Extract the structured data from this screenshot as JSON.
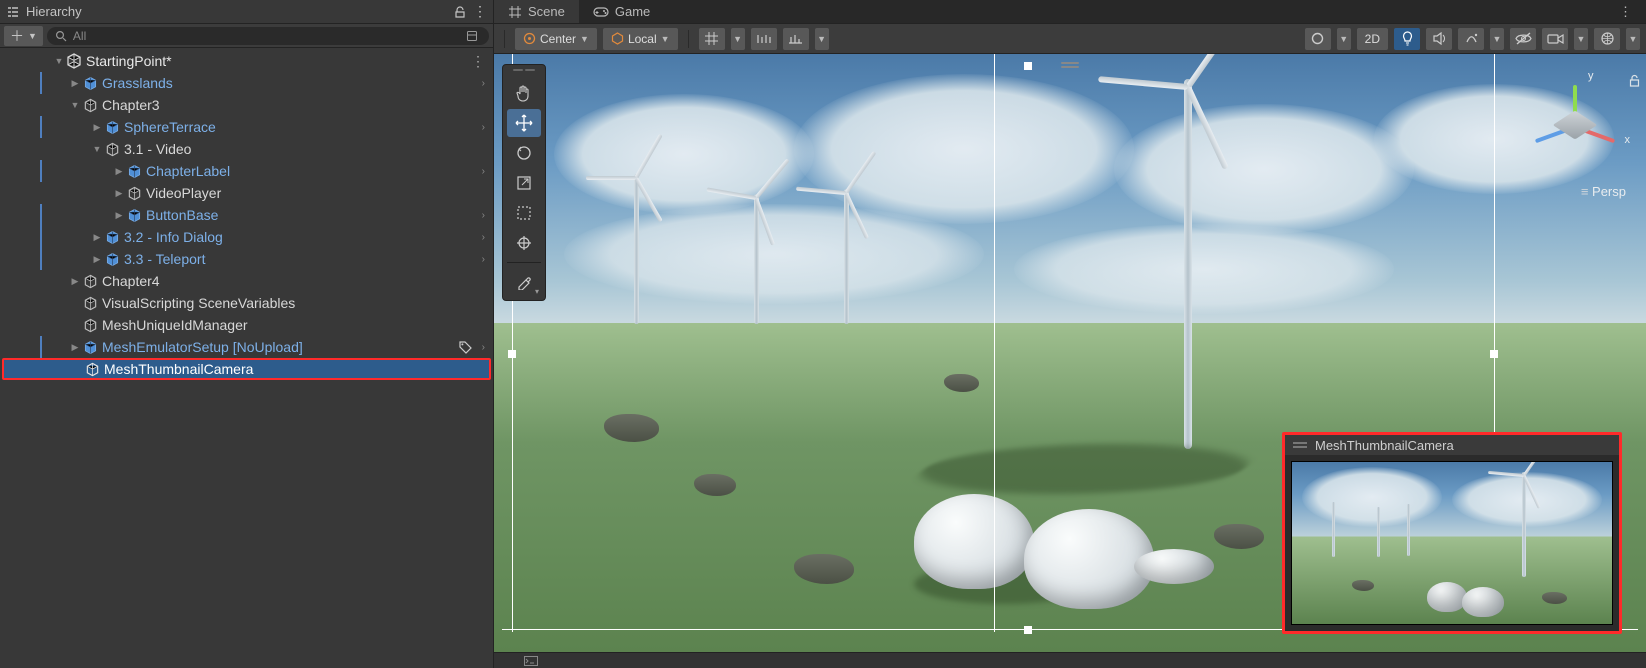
{
  "hierarchy": {
    "title": "Hierarchy",
    "search_placeholder": "All",
    "scene": "StartingPoint*",
    "items": {
      "grasslands": "Grasslands",
      "chapter3": "Chapter3",
      "sphereterrace": "SphereTerrace",
      "video": "3.1 - Video",
      "chapterlabel": "ChapterLabel",
      "videoplayer": "VideoPlayer",
      "buttonbase": "ButtonBase",
      "infodialog": "3.2 - Info Dialog",
      "teleport": "3.3 - Teleport",
      "chapter4": "Chapter4",
      "visualscripting": "VisualScripting SceneVariables",
      "meshuniqueid": "MeshUniqueIdManager",
      "meshemulator": "MeshEmulatorSetup [NoUpload]",
      "meshthumbnail": "MeshThumbnailCamera"
    }
  },
  "scene": {
    "tabs": {
      "scene": "Scene",
      "game": "Game"
    },
    "toolbar": {
      "pivot": "Center",
      "space": "Local",
      "mode2d": "2D"
    },
    "gizmo": {
      "x": "x",
      "y": "y",
      "persp": "Persp"
    },
    "camera_preview_title": "MeshThumbnailCamera"
  }
}
